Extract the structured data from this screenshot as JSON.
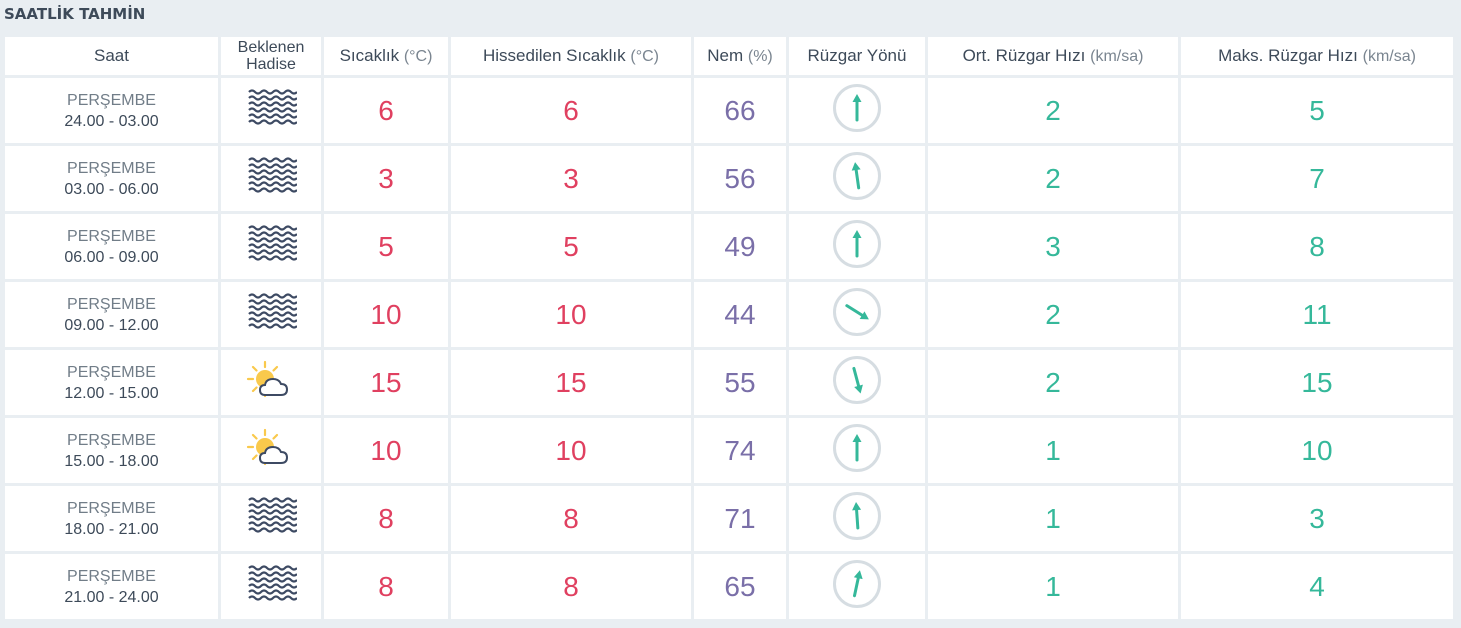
{
  "section_title": "SAATLİK TAHMİN",
  "colors": {
    "temperature": "#e04060",
    "humidity": "#7a6fa8",
    "wind": "#35b89a",
    "wave_icon": "#3d4a63",
    "sun": "#f9c94c"
  },
  "columns": {
    "time": "Saat",
    "condition_line1": "Beklenen",
    "condition_line2": "Hadise",
    "temperature": "Sıcaklık",
    "temperature_unit": "(°C)",
    "feels_like": "Hissedilen Sıcaklık",
    "feels_like_unit": "(°C)",
    "humidity": "Nem",
    "humidity_unit": "(%)",
    "wind_direction": "Rüzgar Yönü",
    "avg_wind": "Ort. Rüzgar Hızı",
    "avg_wind_unit": "(km/sa)",
    "max_wind": "Maks. Rüzgar Hızı",
    "max_wind_unit": "(km/sa)"
  },
  "rows": [
    {
      "day": "PERŞEMBE",
      "range": "24.00 - 03.00",
      "icon": "fog-icon",
      "temp": "6",
      "feels": "6",
      "humidity": "66",
      "wind_dir_deg": 0,
      "avg_wind": "2",
      "max_wind": "5"
    },
    {
      "day": "PERŞEMBE",
      "range": "03.00 - 06.00",
      "icon": "fog-icon",
      "temp": "3",
      "feels": "3",
      "humidity": "56",
      "wind_dir_deg": -8,
      "avg_wind": "2",
      "max_wind": "7"
    },
    {
      "day": "PERŞEMBE",
      "range": "06.00 - 09.00",
      "icon": "fog-icon",
      "temp": "5",
      "feels": "5",
      "humidity": "49",
      "wind_dir_deg": 0,
      "avg_wind": "3",
      "max_wind": "8"
    },
    {
      "day": "PERŞEMBE",
      "range": "09.00 - 12.00",
      "icon": "fog-icon",
      "temp": "10",
      "feels": "10",
      "humidity": "44",
      "wind_dir_deg": 122,
      "avg_wind": "2",
      "max_wind": "11"
    },
    {
      "day": "PERŞEMBE",
      "range": "12.00 - 15.00",
      "icon": "partly-cloudy-icon",
      "temp": "15",
      "feels": "15",
      "humidity": "55",
      "wind_dir_deg": 165,
      "avg_wind": "2",
      "max_wind": "15"
    },
    {
      "day": "PERŞEMBE",
      "range": "15.00 - 18.00",
      "icon": "partly-cloudy-icon",
      "temp": "10",
      "feels": "10",
      "humidity": "74",
      "wind_dir_deg": 0,
      "avg_wind": "1",
      "max_wind": "10"
    },
    {
      "day": "PERŞEMBE",
      "range": "18.00 - 21.00",
      "icon": "fog-icon",
      "temp": "8",
      "feels": "8",
      "humidity": "71",
      "wind_dir_deg": -4,
      "avg_wind": "1",
      "max_wind": "3"
    },
    {
      "day": "PERŞEMBE",
      "range": "21.00 - 24.00",
      "icon": "fog-icon",
      "temp": "8",
      "feels": "8",
      "humidity": "65",
      "wind_dir_deg": 12,
      "avg_wind": "1",
      "max_wind": "4"
    }
  ]
}
